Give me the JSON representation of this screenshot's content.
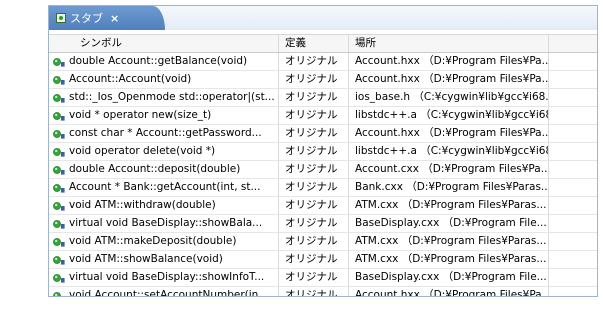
{
  "tab": {
    "title": "スタブ",
    "close_glyph": "×",
    "icon": "stub-view-icon"
  },
  "table": {
    "columns": [
      "シンボル",
      "定義",
      "場所"
    ],
    "row_icon": "function-icon",
    "rows": [
      [
        "double Account::getBalance(void)",
        "オリジナル",
        "Account.hxx （D:¥Program Files¥Pa..."
      ],
      [
        "Account::Account(void)",
        "オリジナル",
        "Account.hxx （D:¥Program Files¥Pa..."
      ],
      [
        "std::_Ios_Openmode std::operator|(st...",
        "オリジナル",
        "ios_base.h （C:¥cygwin¥lib¥gcc¥i68..."
      ],
      [
        "void * operator new(size_t)",
        "オリジナル",
        "libstdc++.a （C:¥cygwin¥lib¥gcc¥i68..."
      ],
      [
        "const char * Account::getPassword...",
        "オリジナル",
        "Account.hxx （D:¥Program Files¥Pa..."
      ],
      [
        "void operator delete(void *)",
        "オリジナル",
        "libstdc++.a （C:¥cygwin¥lib¥gcc¥i68..."
      ],
      [
        "double Account::deposit(double)",
        "オリジナル",
        "Account.cxx （D:¥Program Files¥Pa..."
      ],
      [
        "Account * Bank::getAccount(int, st...",
        "オリジナル",
        "Bank.cxx （D:¥Program Files¥Paras..."
      ],
      [
        "void ATM::withdraw(double)",
        "オリジナル",
        "ATM.cxx （D:¥Program Files¥Paras..."
      ],
      [
        "virtual void BaseDisplay::showBala...",
        "オリジナル",
        "BaseDisplay.cxx （D:¥Program File..."
      ],
      [
        "void ATM::makeDeposit(double)",
        "オリジナル",
        "ATM.cxx （D:¥Program Files¥Paras..."
      ],
      [
        "void ATM::showBalance(void)",
        "オリジナル",
        "ATM.cxx （D:¥Program Files¥Paras..."
      ],
      [
        "virtual void BaseDisplay::showInfoT...",
        "オリジナル",
        "BaseDisplay.cxx （D:¥Program File..."
      ],
      [
        "void Account::setAccountNumber(in...",
        "オリジナル",
        "Account.hxx （D:¥Program Files¥Pa..."
      ]
    ]
  }
}
